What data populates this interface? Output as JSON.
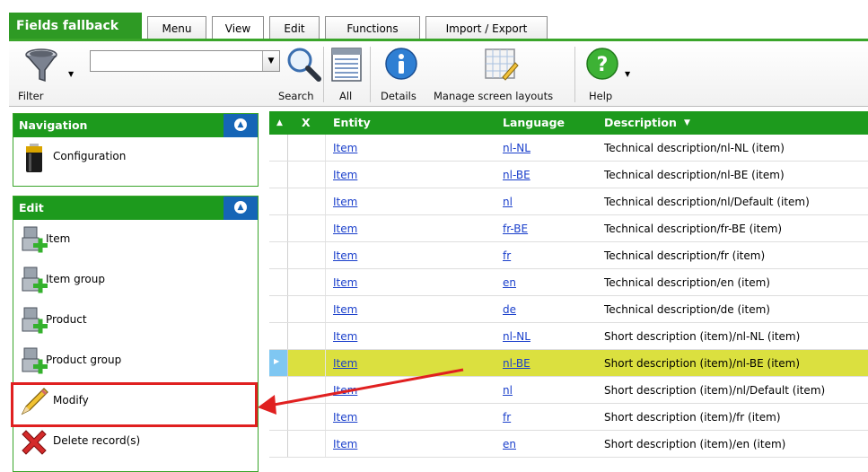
{
  "app": {
    "title": "Fields fallback"
  },
  "tabs": [
    {
      "label": "Menu"
    },
    {
      "label": "View"
    },
    {
      "label": "Edit"
    },
    {
      "label": "Functions"
    },
    {
      "label": "Import / Export"
    }
  ],
  "toolbar": {
    "filter_label": "Filter",
    "filter_value": "",
    "search_label": "Search",
    "all_label": "All",
    "details_label": "Details",
    "layouts_label": "Manage screen layouts",
    "help_label": "Help"
  },
  "navigation": {
    "title": "Navigation",
    "items": [
      {
        "label": "Configuration",
        "icon": "battery-icon"
      }
    ]
  },
  "edit": {
    "title": "Edit",
    "items": [
      {
        "label": "Item",
        "icon": "robot-add-icon"
      },
      {
        "label": "Item group",
        "icon": "robot-add-icon"
      },
      {
        "label": "Product",
        "icon": "robot-add-icon"
      },
      {
        "label": "Product group",
        "icon": "robot-add-icon"
      },
      {
        "label": "Modify",
        "icon": "pencil-icon"
      },
      {
        "label": "Delete record(s)",
        "icon": "red-x-icon"
      }
    ]
  },
  "grid": {
    "columns": {
      "x": "X",
      "entity": "Entity",
      "language": "Language",
      "description": "Description"
    },
    "rows": [
      {
        "entity": "Item",
        "language": "nl-NL",
        "description": "Technical description/nl-NL (item)"
      },
      {
        "entity": "Item",
        "language": "nl-BE",
        "description": "Technical description/nl-BE (item)"
      },
      {
        "entity": "Item",
        "language": "nl",
        "description": "Technical description/nl/Default (item)"
      },
      {
        "entity": "Item",
        "language": "fr-BE",
        "description": "Technical description/fr-BE (item)"
      },
      {
        "entity": "Item",
        "language": "fr",
        "description": "Technical description/fr (item)"
      },
      {
        "entity": "Item",
        "language": "en",
        "description": "Technical description/en (item)"
      },
      {
        "entity": "Item",
        "language": "de",
        "description": "Technical description/de (item)"
      },
      {
        "entity": "Item",
        "language": "nl-NL",
        "description": "Short description (item)/nl-NL (item)"
      },
      {
        "entity": "Item",
        "language": "nl-BE",
        "description": "Short description (item)/nl-BE (item)",
        "selected": true
      },
      {
        "entity": "Item",
        "language": "nl",
        "description": "Short description (item)/nl/Default (item)"
      },
      {
        "entity": "Item",
        "language": "fr",
        "description": "Short description (item)/fr (item)"
      },
      {
        "entity": "Item",
        "language": "en",
        "description": "Short description (item)/en (item)"
      }
    ]
  },
  "colors": {
    "accent_green": "#1d9a1d",
    "collapse_blue": "#1565b6",
    "selected_row": "#dbe03f",
    "annotation_red": "#e02020"
  }
}
